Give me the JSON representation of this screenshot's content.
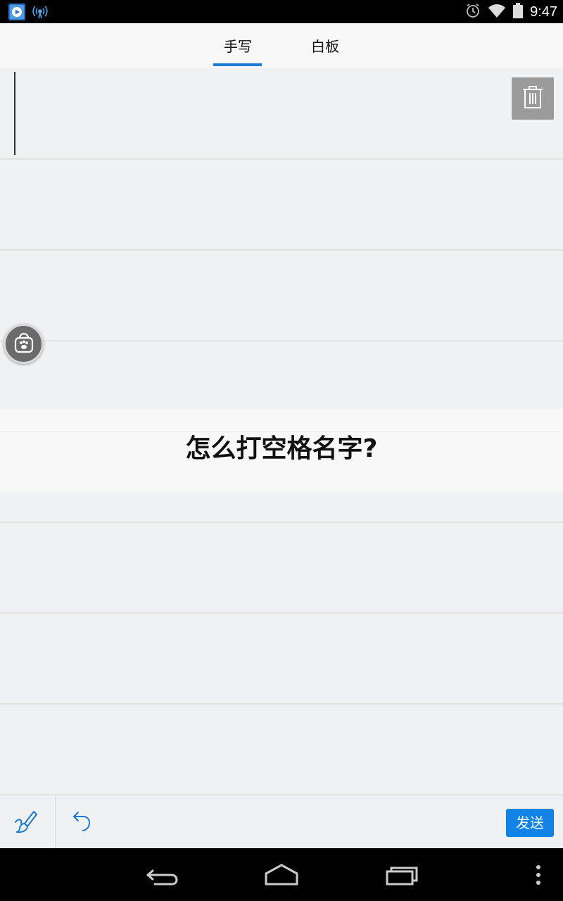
{
  "status_bar": {
    "time": "9:47",
    "icons": [
      "app-player-icon",
      "wireless-signal-icon",
      "alarm-icon",
      "wifi-icon",
      "battery-icon"
    ]
  },
  "tabs": [
    {
      "label": "手写",
      "active": true
    },
    {
      "label": "白板",
      "active": false
    }
  ],
  "canvas": {
    "banner_text": "怎么打空格名字?"
  },
  "toolbar": {
    "send_label": "发送",
    "icons": [
      "brush-icon",
      "undo-icon"
    ]
  },
  "nav_bar": {
    "icons": [
      "back-icon",
      "home-icon",
      "recents-icon",
      "more-options-icon"
    ]
  },
  "colors": {
    "accent": "#1a7ad4",
    "send_button": "#1283e6",
    "canvas_bg": "#f0f1f3",
    "trash_button": "#9b9b9b"
  }
}
